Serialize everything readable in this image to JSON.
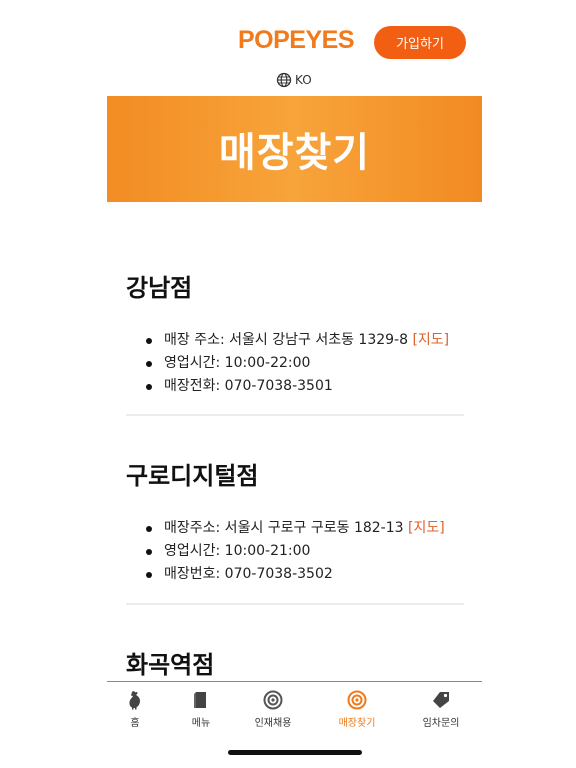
{
  "header": {
    "logo_text": "Popeyes",
    "join_label": "가입하기"
  },
  "language": {
    "code": "KO",
    "icon": "globe-icon"
  },
  "banner": {
    "title": "매장찾기"
  },
  "stores": [
    {
      "name": "강남점",
      "address_label": "매장 주소: 서울시 강남구 서초동 1329-8",
      "map_label": "[지도]",
      "hours": "영업시간: 10:00-22:00",
      "phone": "매장전화: 070-7038-3501"
    },
    {
      "name": "구로디지털점",
      "address_label": "매장주소: 서울시 구로구 구로동 182-13",
      "map_label": "[지도]",
      "hours": "영업시간: 10:00-21:00",
      "phone": "매장번호: 070-7038-3502"
    },
    {
      "name": "화곡역점"
    }
  ],
  "tabbar": {
    "tabs": [
      {
        "label": "홈",
        "icon": "chicken-icon",
        "active": false
      },
      {
        "label": "메뉴",
        "icon": "menu-book-icon",
        "active": false
      },
      {
        "label": "인재채용",
        "icon": "recruit-icon",
        "active": false
      },
      {
        "label": "매장찾기",
        "icon": "store-locator-icon",
        "active": true
      },
      {
        "label": "임차문의",
        "icon": "tag-icon",
        "active": false
      }
    ]
  },
  "colors": {
    "brand_orange": "#f27a1a",
    "button_orange": "#f25e12",
    "map_link": "#e0602a",
    "active_tab": "#f07a1a"
  }
}
